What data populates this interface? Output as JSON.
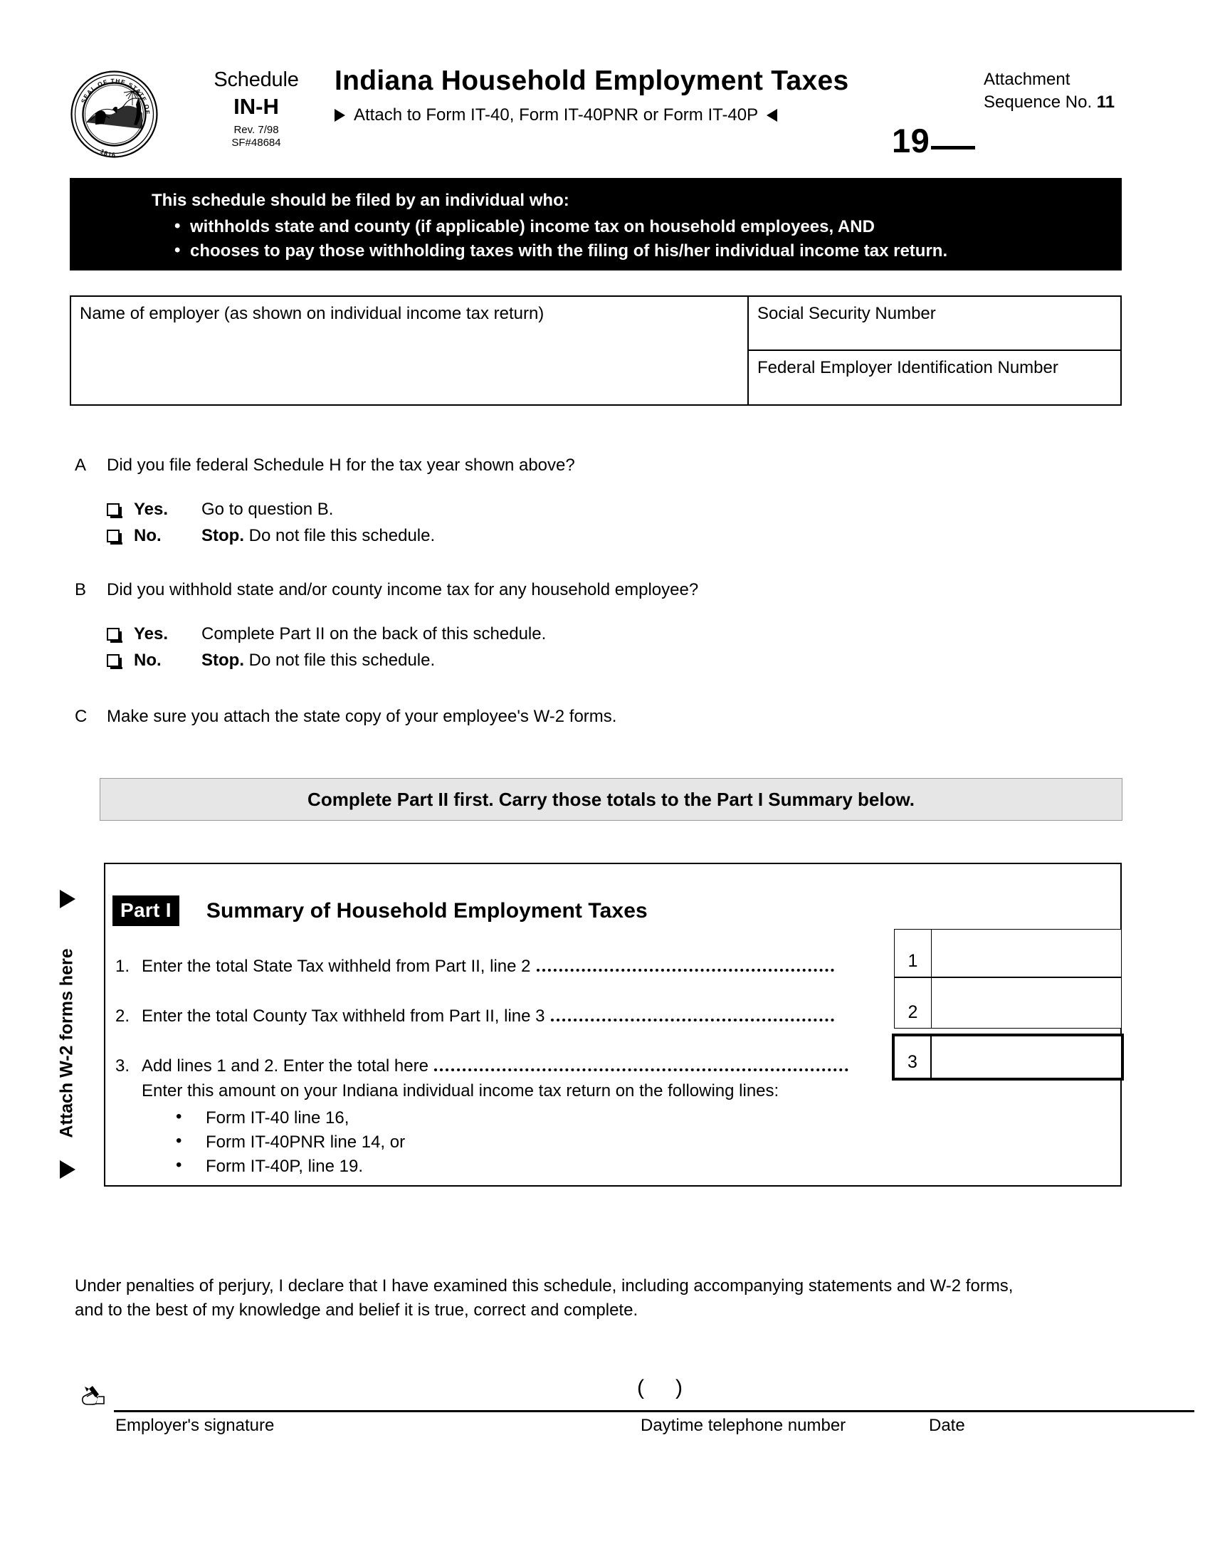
{
  "header": {
    "seal_alt": "seal-of-the-state-of-indiana",
    "schedule_word": "Schedule",
    "schedule_code": "IN-H",
    "revision": "Rev. 7/98",
    "form_number": "SF#48684",
    "title": "Indiana Household Employment Taxes",
    "attach_instruction": "Attach to Form IT-40, Form IT-40PNR or Form IT-40P",
    "attachment_label": "Attachment",
    "sequence_label": "Sequence No.",
    "sequence_number": "11",
    "year_prefix": "19"
  },
  "black_banner": {
    "heading": "This schedule should be filed by an individual who:",
    "bullets": [
      "withholds state and county (if  applicable) income tax on household employees,  AND",
      "chooses to pay those withholding taxes with the filing of his/her individual income tax return."
    ]
  },
  "identity": {
    "name_label": "Name of employer (as shown on individual income tax return)",
    "ssn_label": "Social Security Number",
    "fein_label": "Federal Employer Identification Number",
    "name_value": "",
    "ssn_value": "",
    "fein_value": ""
  },
  "questions": [
    {
      "letter": "A",
      "text": "Did you file federal Schedule H for the tax year shown above?",
      "options": [
        {
          "label": "Yes.",
          "action_bold": "",
          "action": "Go to question B.",
          "checked": false
        },
        {
          "label": "No.",
          "action_bold": "Stop.",
          "action": " Do not file this schedule.",
          "checked": false
        }
      ]
    },
    {
      "letter": "B",
      "text": "Did you withhold state and/or county income tax for any household employee?",
      "options": [
        {
          "label": "Yes.",
          "action_bold": "",
          "action": "Complete Part II on the back of this schedule.",
          "checked": false
        },
        {
          "label": "No.",
          "action_bold": "Stop.",
          "action": " Do not file this schedule.",
          "checked": false
        }
      ]
    },
    {
      "letter": "C",
      "text": "Make sure you attach the state copy of your employee's W-2 forms.",
      "options": []
    }
  ],
  "gray_banner": {
    "text": "Complete Part II first.  Carry those totals to the Part I Summary below."
  },
  "part1": {
    "tag": "Part I",
    "title": "Summary of Household Employment Taxes",
    "lines": [
      {
        "num": "1.",
        "text": "Enter the total State Tax withheld from Part II, line 2",
        "box_num": "1",
        "value": ""
      },
      {
        "num": "2.",
        "text": "Enter the total County Tax withheld from Part II, line 3",
        "box_num": "2",
        "value": ""
      },
      {
        "num": "3.",
        "text": "Add lines 1 and 2.  Enter the total here",
        "box_num": "3",
        "value": ""
      }
    ],
    "sub_note": "Enter this amount on your Indiana individual income tax return on the following lines:",
    "bullets": [
      "Form IT-40 line 16,",
      "Form IT-40PNR line 14, or",
      "Form IT-40P, line 19."
    ]
  },
  "side_label": {
    "text": "Attach W-2 forms here"
  },
  "signature": {
    "perjury_line1": "Under penalties of perjury, I declare that I have examined this schedule, including accompanying statements and W-2 forms,",
    "perjury_line2": "and to the best of my knowledge and belief it is true, correct and complete.",
    "caption_signature": "Employer's signature",
    "caption_phone": "Daytime telephone number",
    "caption_date": "Date",
    "area_code_open": "(",
    "area_code_close": ")"
  },
  "colors": {
    "banner_black": "#000000",
    "banner_gray": "#e6e6e6",
    "page_bg": "#ffffff",
    "ink": "#000000"
  }
}
